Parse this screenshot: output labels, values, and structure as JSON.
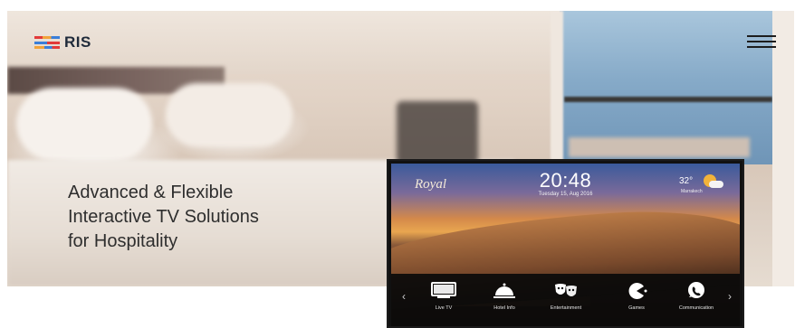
{
  "header": {
    "logo_text": "RIS",
    "logo_colors": [
      "#e23a3a",
      "#f2a33a",
      "#3a7fd9"
    ],
    "menu_icon": "hamburger-menu-icon"
  },
  "hero": {
    "headline_line1": "Advanced & Flexible",
    "headline_line2": "Interactive TV Solutions",
    "headline_line3": "for Hospitality"
  },
  "tv": {
    "brand": "Royal",
    "time": "20:48",
    "date": "Tuesday 15, Aug 2016",
    "temperature": "32°",
    "city": "Marrakech",
    "nav_prev": "‹",
    "nav_next": "›",
    "menu": [
      {
        "label": "Live TV",
        "icon": "tv-icon"
      },
      {
        "label": "Hotel Info",
        "icon": "service-bell-icon"
      },
      {
        "label": "Entertainment",
        "icon": "theater-masks-icon"
      },
      {
        "label": "Games",
        "icon": "pacman-icon"
      },
      {
        "label": "Communication",
        "icon": "phone-chat-icon"
      }
    ]
  }
}
